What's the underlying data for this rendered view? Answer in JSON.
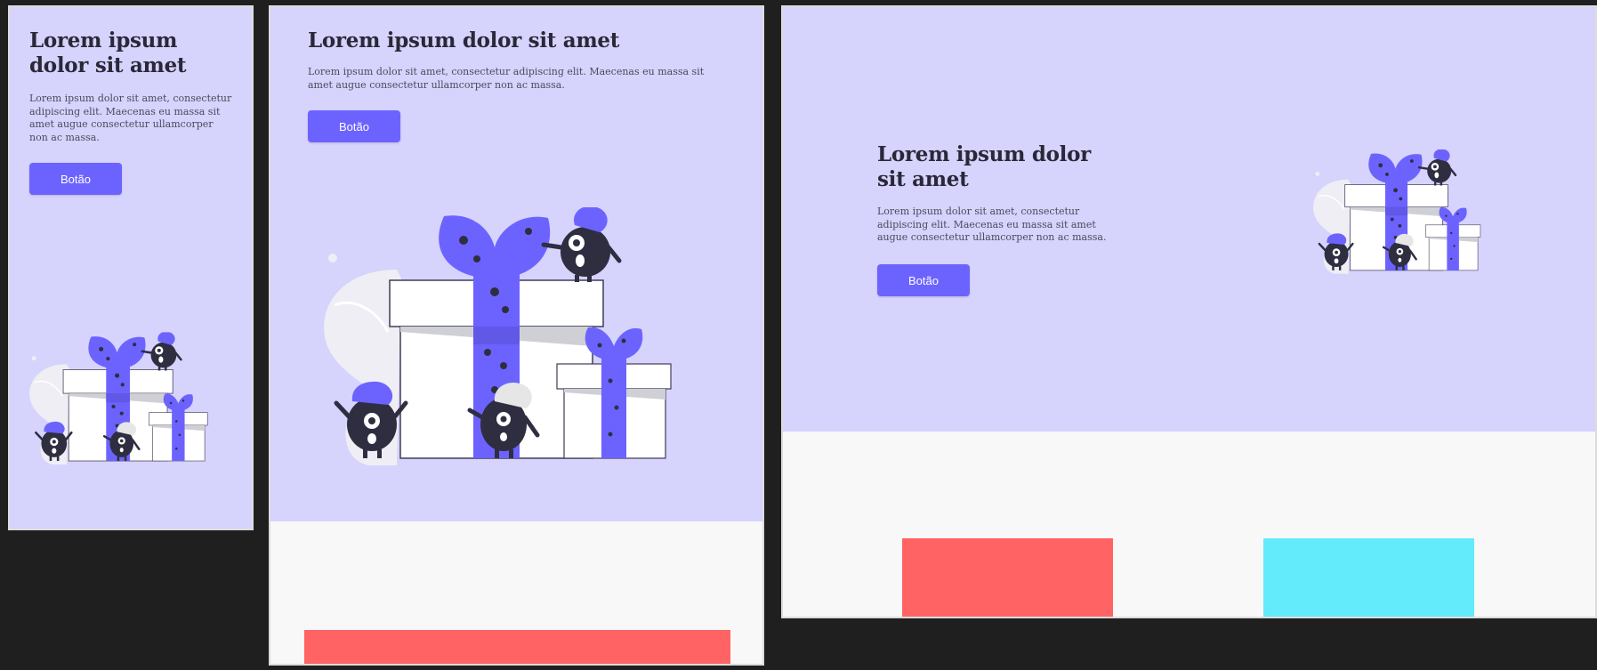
{
  "colors": {
    "hero_bg": "#d6d3fd",
    "accent": "#6c63ff",
    "card_red": "#ff6363",
    "card_cyan": "#63ebfb",
    "page_bg": "#f8f8f8",
    "desktop_bg": "#1f1f1f"
  },
  "previews": {
    "mobile": {
      "title": "Lorem ipsum dolor sit amet",
      "description": "Lorem ipsum dolor sit amet, consectetur adipiscing elit. Maecenas eu massa sit amet augue consectetur ullamcorper non ac massa.",
      "button_label": "Botão",
      "illustration_icon": "gift-boxes-monsters-illustration"
    },
    "tablet": {
      "title": "Lorem ipsum dolor sit amet",
      "description": "Lorem ipsum dolor sit amet, consectetur adipiscing elit. Maecenas eu massa sit amet augue consectetur ullamcorper non ac massa.",
      "button_label": "Botão",
      "illustration_icon": "gift-boxes-monsters-illustration"
    },
    "desktop": {
      "title": "Lorem ipsum dolor sit amet",
      "description": "Lorem ipsum dolor sit amet, consectetur adipiscing elit. Maecenas eu massa sit amet augue consectetur ullamcorper non ac massa.",
      "button_label": "Botão",
      "illustration_icon": "gift-boxes-monsters-illustration"
    }
  }
}
